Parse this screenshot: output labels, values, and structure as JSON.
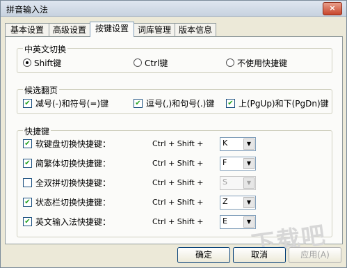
{
  "window": {
    "title": "拼音输入法",
    "close_glyph": "×"
  },
  "tabs": [
    {
      "label": "基本设置",
      "active": false
    },
    {
      "label": "高级设置",
      "active": false
    },
    {
      "label": "按键设置",
      "active": true
    },
    {
      "label": "词库管理",
      "active": false
    },
    {
      "label": "版本信息",
      "active": false
    }
  ],
  "switch_group": {
    "legend": "中英文切换",
    "options": [
      {
        "label": "Shift键",
        "checked": true
      },
      {
        "label": "Ctrl键",
        "checked": false
      },
      {
        "label": "不使用快捷键",
        "checked": false
      }
    ]
  },
  "page_group": {
    "legend": "候选翻页",
    "options": [
      {
        "label": "减号(-)和符号(=)键",
        "checked": true
      },
      {
        "label": "逗号(,)和句号(.)键",
        "checked": true
      },
      {
        "label": "上(PgUp)和下(PgDn)键",
        "checked": true
      }
    ]
  },
  "hotkey_group": {
    "legend": "快捷键",
    "combo": "Ctrl + Shift +",
    "rows": [
      {
        "label": "软键盘切换快捷键：",
        "checked": true,
        "key": "K",
        "enabled": true
      },
      {
        "label": "简繁体切换快捷键：",
        "checked": true,
        "key": "F",
        "enabled": true
      },
      {
        "label": "全双拼切换快捷键：",
        "checked": false,
        "key": "S",
        "enabled": false
      },
      {
        "label": "状态栏切换快捷键：",
        "checked": true,
        "key": "Z",
        "enabled": true
      },
      {
        "label": "英文输入法快捷键：",
        "checked": true,
        "key": "E",
        "enabled": true
      }
    ]
  },
  "buttons": {
    "ok": "确定",
    "cancel": "取消",
    "apply": "应用(A)"
  },
  "watermark": "下载吧"
}
